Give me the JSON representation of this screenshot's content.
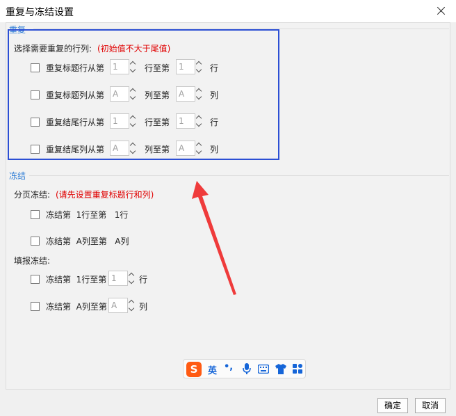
{
  "dialog": {
    "title": "重复与冻结设置"
  },
  "repeat": {
    "legend": "重复",
    "instruction": "选择需要重复的行列:",
    "note": "(初始值不大于尾值)",
    "rows": [
      {
        "label_from": "重复标题行从第",
        "start": "1",
        "label_to": "行至第",
        "end": "1",
        "unit": "行"
      },
      {
        "label_from": "重复标题列从第",
        "start": "A",
        "label_to": "列至第",
        "end": "A",
        "unit": "列"
      },
      {
        "label_from": "重复结尾行从第",
        "start": "1",
        "label_to": "行至第",
        "end": "1",
        "unit": "行"
      },
      {
        "label_from": "重复结尾列从第",
        "start": "A",
        "label_to": "列至第",
        "end": "A",
        "unit": "列"
      }
    ]
  },
  "freeze": {
    "legend": "冻结",
    "paging_label": "分页冻结:",
    "paging_note": "(请先设置重复标题行和列)",
    "paging_items": [
      "冻结第  1行至第   1行",
      "冻结第  A列至第   A列"
    ],
    "fill_label": "填报冻结:",
    "fill_items": [
      {
        "prefix": "冻结第  1行至第",
        "value": "1",
        "unit": "行"
      },
      {
        "prefix": "冻结第  A列至第",
        "value": "A",
        "unit": "列"
      }
    ]
  },
  "ime": {
    "logo": "S",
    "mode": "英",
    "punct": "•,",
    "icons": [
      "microphone-icon",
      "keyboard-icon",
      "shirt-icon",
      "apps-icon"
    ]
  },
  "footer": {
    "ok": "确定",
    "cancel": "取消"
  },
  "colors": {
    "accent_legend": "#2e7dd6",
    "note_red": "#e00000",
    "highlight_box": "#2c4fd4",
    "arrow": "#ef3b3b",
    "ime_brand": "#ff5a12"
  }
}
